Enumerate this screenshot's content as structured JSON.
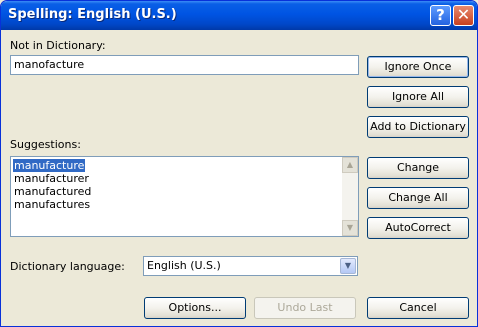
{
  "window": {
    "title": "Spelling: English (U.S.)",
    "help_symbol": "?",
    "close_symbol": "✕"
  },
  "not_in_dictionary": {
    "label": "Not in Dictionary:",
    "value": "manofacture"
  },
  "suggestions": {
    "label": "Suggestions:",
    "items": [
      "manufacture",
      "manufacturer",
      "manufactured",
      "manufactures"
    ],
    "selected_index": 0
  },
  "dictionary_language": {
    "label": "Dictionary language:",
    "value": "English (U.S.)"
  },
  "buttons": {
    "ignore_once": "Ignore Once",
    "ignore_all": "Ignore All",
    "add_to_dictionary": "Add to Dictionary",
    "change": "Change",
    "change_all": "Change All",
    "autocorrect": "AutoCorrect",
    "options": "Options...",
    "undo_last": "Undo Last",
    "cancel": "Cancel"
  },
  "icons": {
    "help": "help-icon",
    "close": "close-icon",
    "scroll_up": "scroll-up-arrow-icon",
    "scroll_down": "scroll-down-arrow-icon",
    "dropdown": "dropdown-arrow-icon"
  },
  "colors": {
    "titlebar": "#0054e3",
    "selection": "#316ac5",
    "window_bg": "#ece9d8"
  }
}
